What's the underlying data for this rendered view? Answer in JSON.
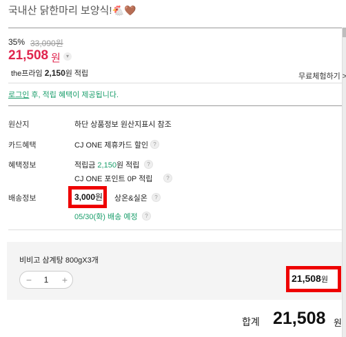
{
  "product": {
    "title": "국내산 닭한마리 보양식!",
    "title_emoji": "🐔🤎"
  },
  "price": {
    "discount": "35%",
    "original": "33,090원",
    "sale": "21,508",
    "sale_unit": "원",
    "dropdown_glyph": "▾"
  },
  "membership": {
    "prime_prefix": "the프라임",
    "prime_amount": "2,150",
    "prime_suffix": "원 적립",
    "free_trial": "무료체험하기 >"
  },
  "login_notice": {
    "link": "로그인",
    "text": " 후, 적립 혜택이 제공됩니다."
  },
  "info": {
    "origin_label": "원산지",
    "origin_value": "하단 상품정보 원산지표시 참조",
    "card_label": "카드혜택",
    "card_value": "CJ ONE 제휴카드 할인",
    "benefit_label": "혜택정보",
    "benefit_line1_prefix": "적립금 ",
    "benefit_line1_amount": "2,150",
    "benefit_line1_suffix": "원 적립",
    "benefit_line2": "CJ ONE 포인트 0P 적립",
    "shipping_label": "배송정보",
    "shipping_fee": "3,000",
    "shipping_unit": "원",
    "shipping_type": "상온&실온",
    "delivery_date": "05/30(화) 배송 예정",
    "info_glyph": "?"
  },
  "option": {
    "name": "비비고 삼계탕 800gX3개",
    "quantity": "1",
    "minus": "−",
    "plus": "+",
    "subtotal": "21,508",
    "subtotal_unit": "원"
  },
  "total": {
    "label": "합계",
    "amount": "21,508",
    "unit": "원"
  },
  "colors": {
    "accent_red": "#e0254e",
    "green": "#1a9e6b",
    "highlight_box": "#ee0000"
  }
}
